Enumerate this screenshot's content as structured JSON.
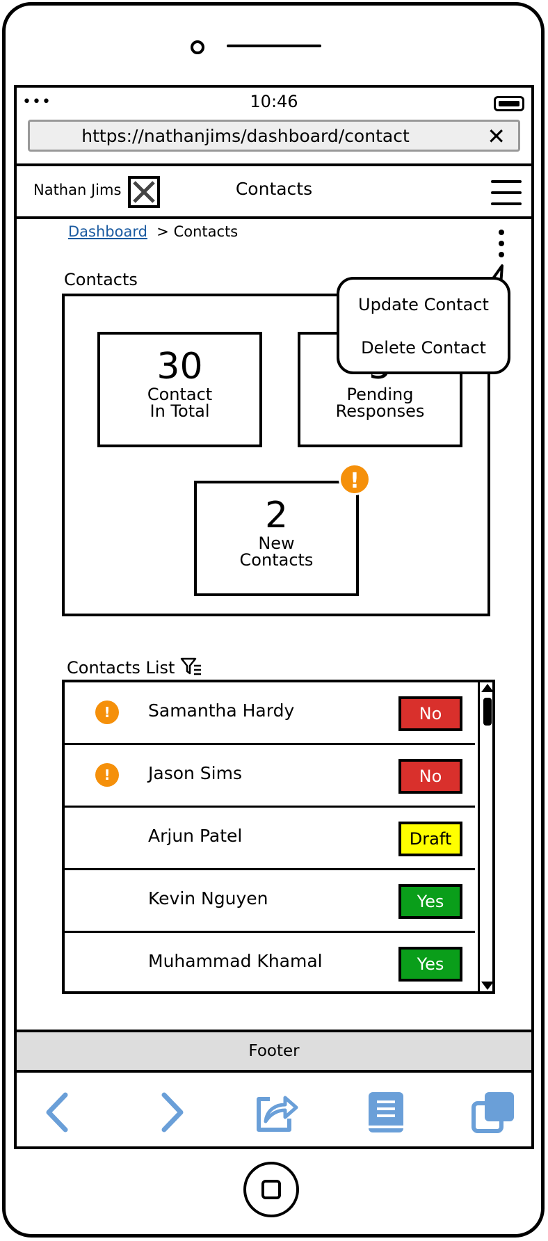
{
  "status_bar": {
    "signal": "•••",
    "time": "10:46"
  },
  "browser": {
    "url": "https://nathanjims/dashboard/contact",
    "close_symbol": "✕"
  },
  "navbar": {
    "user_name": "Nathan Jims",
    "page_title": "Contacts"
  },
  "breadcrumb": {
    "link": "Dashboard",
    "separator": ">",
    "current": "Contacts"
  },
  "context_menu": {
    "items": [
      "Update Contact",
      "Delete Contact"
    ]
  },
  "summary": {
    "label": "Contacts",
    "cards": [
      {
        "value": "30",
        "line1": "Contact",
        "line2": "In Total"
      },
      {
        "value": "5",
        "line1": "Pending",
        "line2": "Responses"
      },
      {
        "value": "2",
        "line1": "New",
        "line2": "Contacts",
        "alert": "!"
      }
    ]
  },
  "contacts_list": {
    "label": "Contacts List",
    "filter_icon": "filter-icon",
    "rows": [
      {
        "name": "Samantha Hardy",
        "status": "No",
        "alert": true
      },
      {
        "name": "Jason Sims",
        "status": "No",
        "alert": true
      },
      {
        "name": "Arjun Patel",
        "status": "Draft",
        "alert": false
      },
      {
        "name": "Kevin Nguyen",
        "status": "Yes",
        "alert": false
      },
      {
        "name": "Muhammad Khamal",
        "status": "Yes",
        "alert": false
      }
    ],
    "status_colors": {
      "No": "#d9302c",
      "Draft": "#ffff00",
      "Yes": "#0a9e1a"
    },
    "status_text_colors": {
      "No": "#ffffff",
      "Draft": "#000000",
      "Yes": "#ffffff"
    }
  },
  "footer": {
    "text": "Footer"
  },
  "bottom_bar": {
    "icons": [
      "back-icon",
      "forward-icon",
      "share-icon",
      "bookmarks-icon",
      "tabs-icon"
    ],
    "icon_color": "#6a9fd8"
  },
  "colors": {
    "alert": "#f5900a",
    "link": "#1a5aa0"
  }
}
